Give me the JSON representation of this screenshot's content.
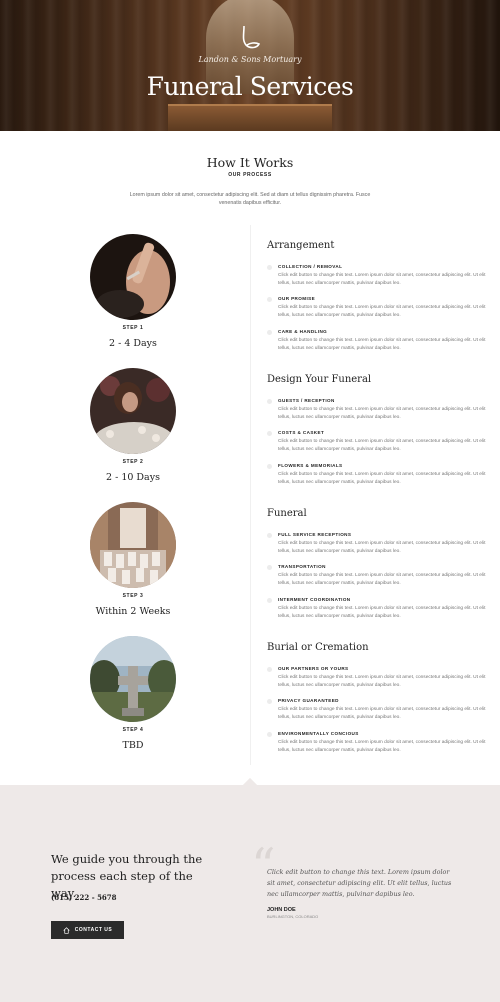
{
  "hero": {
    "brand": "Landon & Sons Mortuary",
    "title": "Funeral Services"
  },
  "how_it_works": {
    "title": "How It Works",
    "subtitle": "OUR PROCESS",
    "description": "Lorem ipsum dolor sit amet, consectetur adipiscing elit. Sed at diam ut tellus dignissim pharetra. Fusce venenatis dapibus efficitur."
  },
  "steps": [
    {
      "label": "STEP 1",
      "duration": "2 - 4 Days",
      "title": "Arrangement",
      "items": [
        {
          "title": "COLLECTION / REMOVAL",
          "body": "Click edit button to change this text. Lorem ipsum dolor sit amet, consectetur adipiscing elit. Ut elit tellus, luctus nec ullamcorper mattis, pulvinar dapibus leo."
        },
        {
          "title": "OUR PROMISE",
          "body": "Click edit button to change this text. Lorem ipsum dolor sit amet, consectetur adipiscing elit. Ut elit tellus, luctus nec ullamcorper mattis, pulvinar dapibus leo."
        },
        {
          "title": "CARE & HANDLING",
          "body": "Click edit button to change this text. Lorem ipsum dolor sit amet, consectetur adipiscing elit. Ut elit tellus, luctus nec ullamcorper mattis, pulvinar dapibus leo."
        }
      ]
    },
    {
      "label": "STEP 2",
      "duration": "2 - 10 Days",
      "title": "Design Your Funeral",
      "items": [
        {
          "title": "GUESTS / RECEPTION",
          "body": "Click edit button to change this text. Lorem ipsum dolor sit amet, consectetur adipiscing elit. Ut elit tellus, luctus nec ullamcorper mattis, pulvinar dapibus leo."
        },
        {
          "title": "COSTS & CASKET",
          "body": "Click edit button to change this text. Lorem ipsum dolor sit amet, consectetur adipiscing elit. Ut elit tellus, luctus nec ullamcorper mattis, pulvinar dapibus leo."
        },
        {
          "title": "FLOWERS & MEMORIALS",
          "body": "Click edit button to change this text. Lorem ipsum dolor sit amet, consectetur adipiscing elit. Ut elit tellus, luctus nec ullamcorper mattis, pulvinar dapibus leo."
        }
      ]
    },
    {
      "label": "STEP 3",
      "duration": "Within 2 Weeks",
      "title": "Funeral",
      "items": [
        {
          "title": "FULL SERVICE RECEPTIONS",
          "body": "Click edit button to change this text. Lorem ipsum dolor sit amet, consectetur adipiscing elit. Ut elit tellus, luctus nec ullamcorper mattis, pulvinar dapibus leo."
        },
        {
          "title": "TRANSPORTATION",
          "body": "Click edit button to change this text. Lorem ipsum dolor sit amet, consectetur adipiscing elit. Ut elit tellus, luctus nec ullamcorper mattis, pulvinar dapibus leo."
        },
        {
          "title": "INTERMENT COORDINATION",
          "body": "Click edit button to change this text. Lorem ipsum dolor sit amet, consectetur adipiscing elit. Ut elit tellus, luctus nec ullamcorper mattis, pulvinar dapibus leo."
        }
      ]
    },
    {
      "label": "STEP 4",
      "duration": "TBD",
      "title": "Burial or Cremation",
      "items": [
        {
          "title": "OUR PARTNERS OR YOURS",
          "body": "Click edit button to change this text. Lorem ipsum dolor sit amet, consectetur adipiscing elit. Ut elit tellus, luctus nec ullamcorper mattis, pulvinar dapibus leo."
        },
        {
          "title": "PRIVACY GUARANTEED",
          "body": "Click edit button to change this text. Lorem ipsum dolor sit amet, consectetur adipiscing elit. Ut elit tellus, luctus nec ullamcorper mattis, pulvinar dapibus leo."
        },
        {
          "title": "ENVIRONMENTALLY CONCIOUS",
          "body": "Click edit button to change this text. Lorem ipsum dolor sit amet, consectetur adipiscing elit. Ut elit tellus, luctus nec ullamcorper mattis, pulvinar dapibus leo."
        }
      ]
    }
  ],
  "guide": {
    "heading": "We guide you through the process each step of the way.",
    "phone": "(615) 222 - 5678",
    "button_label": "CONTACT US",
    "button_icon": "home-icon"
  },
  "testimonial": {
    "quote": "Click edit button to change this text. Lorem ipsum dolor sit amet, consectetur adipiscing elit. Ut elit tellus, luctus nec ullamcorper mattis, pulvinar dapibus leo.",
    "name": "JOHN DOE",
    "location": "BURLINGTON, COLORADO"
  },
  "colors": {
    "hero_dark": "#2a1a0f",
    "bottom_bg": "#eee9e8",
    "button_bg": "#2b2b2b"
  }
}
